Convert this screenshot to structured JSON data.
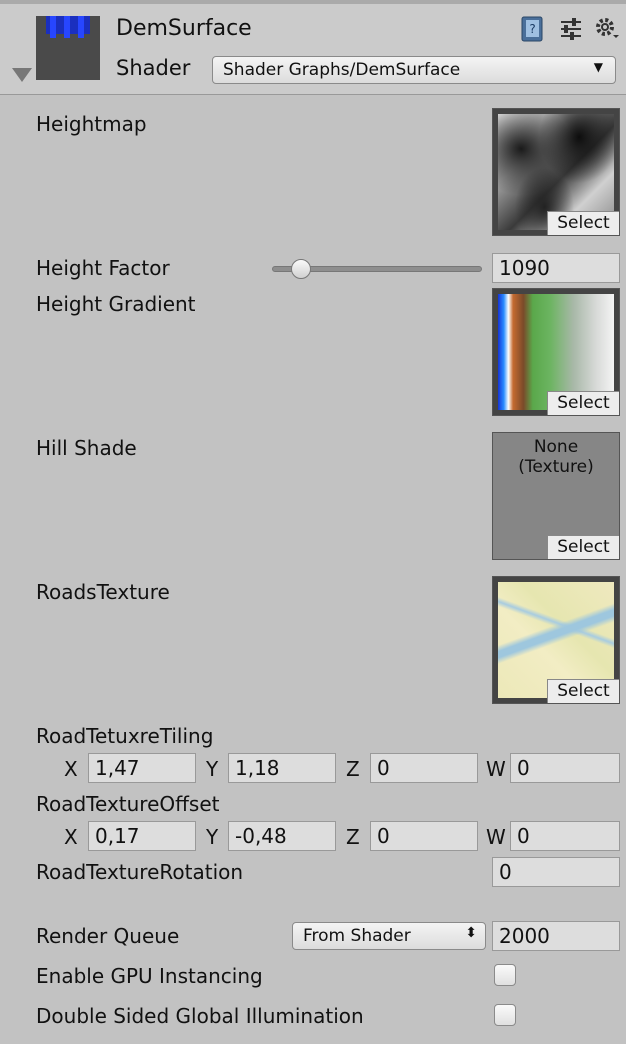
{
  "header": {
    "material_name": "DemSurface",
    "shader_label": "Shader",
    "shader_value": "Shader Graphs/DemSurface",
    "icons": [
      "help-book-icon",
      "preset-sliders-icon",
      "gear-settings-icon"
    ]
  },
  "properties": {
    "heightmap": {
      "label": "Heightmap",
      "select_label": "Select"
    },
    "height_factor": {
      "label": "Height Factor",
      "value": "1090",
      "slider_fraction": 0.14
    },
    "height_gradient": {
      "label": "Height Gradient",
      "select_label": "Select"
    },
    "hill_shade": {
      "label": "Hill Shade",
      "none_text": "None\n(Texture)",
      "select_label": "Select"
    },
    "roads_texture": {
      "label": "RoadsTexture",
      "select_label": "Select"
    },
    "road_tiling": {
      "label": "RoadTetuxreTiling",
      "x_label": "X",
      "x": "1,47",
      "y_label": "Y",
      "y": "1,18",
      "z_label": "Z",
      "z": "0",
      "w_label": "W",
      "w": "0"
    },
    "road_offset": {
      "label": "RoadTextureOffset",
      "x_label": "X",
      "x": "0,17",
      "y_label": "Y",
      "y": "-0,48",
      "z_label": "Z",
      "z": "0",
      "w_label": "W",
      "w": "0"
    },
    "road_rotation": {
      "label": "RoadTextureRotation",
      "value": "0"
    }
  },
  "advanced": {
    "render_queue": {
      "label": "Render Queue",
      "mode": "From Shader",
      "value": "2000"
    },
    "gpu_instancing": {
      "label": "Enable GPU Instancing",
      "checked": false
    },
    "double_sided_gi": {
      "label": "Double Sided Global Illumination",
      "checked": false
    }
  }
}
